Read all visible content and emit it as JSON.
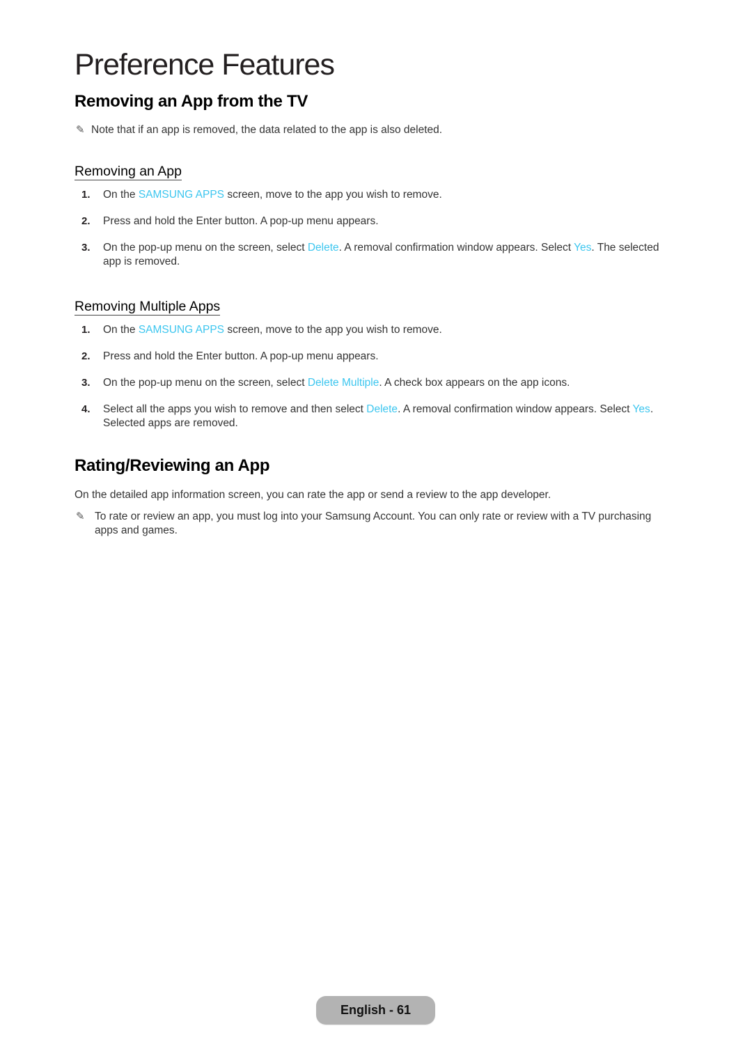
{
  "page_title": "Preference Features",
  "section1": {
    "heading": "Removing an App from the TV",
    "note": {
      "icon": "pencil-note-icon",
      "text": "Note that if an app is removed, the data related to the app is also deleted."
    },
    "sub1": {
      "heading": "Removing an App",
      "steps": [
        {
          "num": "1.",
          "parts": [
            {
              "text": "On the ",
              "highlight": false
            },
            {
              "text": "SAMSUNG APPS",
              "highlight": true
            },
            {
              "text": " screen, move to the app you wish to remove.",
              "highlight": false
            }
          ]
        },
        {
          "num": "2.",
          "parts": [
            {
              "text": "Press and hold the Enter button. A pop-up menu appears.",
              "highlight": false
            }
          ]
        },
        {
          "num": "3.",
          "parts": [
            {
              "text": "On the pop-up menu on the screen, select ",
              "highlight": false
            },
            {
              "text": "Delete",
              "highlight": true
            },
            {
              "text": ". A removal confirmation window appears. Select ",
              "highlight": false
            },
            {
              "text": "Yes",
              "highlight": true
            },
            {
              "text": ". The selected app is removed.",
              "highlight": false
            }
          ]
        }
      ]
    },
    "sub2": {
      "heading": "Removing Multiple Apps",
      "steps": [
        {
          "num": "1.",
          "parts": [
            {
              "text": "On the ",
              "highlight": false
            },
            {
              "text": "SAMSUNG APPS",
              "highlight": true
            },
            {
              "text": " screen, move to the app you wish to remove.",
              "highlight": false
            }
          ]
        },
        {
          "num": "2.",
          "parts": [
            {
              "text": "Press and hold the Enter button. A pop-up menu appears.",
              "highlight": false
            }
          ]
        },
        {
          "num": "3.",
          "parts": [
            {
              "text": "On the pop-up menu on the screen, select ",
              "highlight": false
            },
            {
              "text": "Delete Multiple",
              "highlight": true
            },
            {
              "text": ". A check box appears on the app icons.",
              "highlight": false
            }
          ]
        },
        {
          "num": "4.",
          "parts": [
            {
              "text": "Select all the apps you wish to remove and then select ",
              "highlight": false
            },
            {
              "text": "Delete",
              "highlight": true
            },
            {
              "text": ". A removal confirmation window appears. Select ",
              "highlight": false
            },
            {
              "text": "Yes",
              "highlight": true
            },
            {
              "text": ". Selected apps are removed.",
              "highlight": false
            }
          ]
        }
      ]
    }
  },
  "section2": {
    "heading": "Rating/Reviewing an App",
    "paragraph": "On the detailed app information screen, you can rate the app or send a review to the app developer.",
    "note": {
      "icon": "pencil-note-icon",
      "text": "To rate or review an app, you must log into your Samsung Account. You can only rate or review with a TV purchasing apps and games."
    }
  },
  "footer": {
    "page_label": "English - 61"
  },
  "colors": {
    "highlight": "#3cc6ef",
    "text": "#333333",
    "pill": "#b3b3b3"
  }
}
